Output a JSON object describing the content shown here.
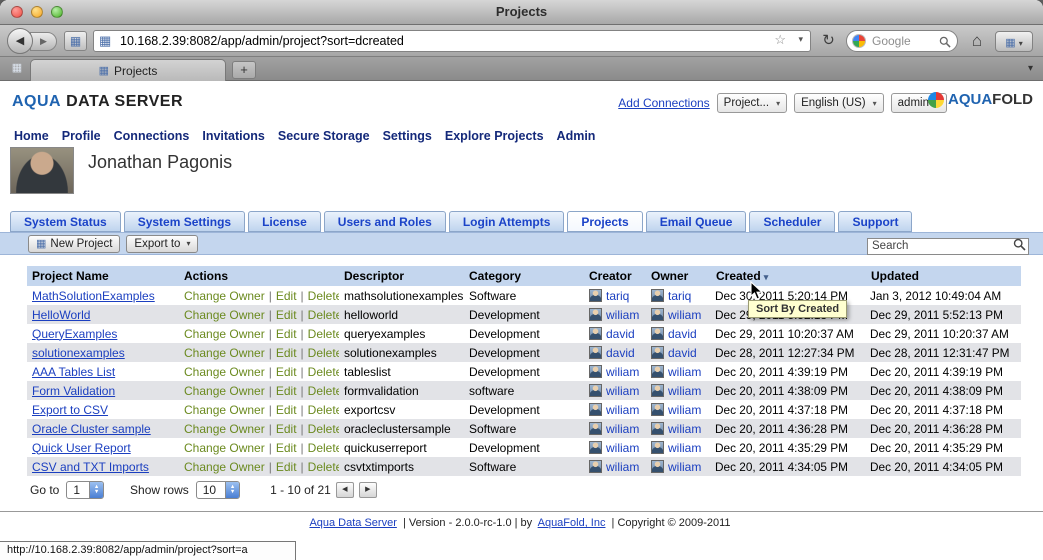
{
  "browser": {
    "window_title": "Projects",
    "url": "10.168.2.39:8082/app/admin/project?sort=dcreated",
    "search_placeholder": "Google",
    "tab_title": "Projects",
    "new_tab": "+",
    "status_url": "http://10.168.2.39:8082/app/admin/project?sort=a"
  },
  "icons": {
    "back": "◀",
    "forward": "▶",
    "grid": "▦",
    "star": "☆",
    "caret_small": "▾",
    "caret": "▼",
    "up": "▲",
    "down": "▼",
    "reload": "↻",
    "home": "⌂",
    "prev": "◀",
    "next": "▶",
    "sort_desc": "▾",
    "plus": "+"
  },
  "header": {
    "logo_aqua": "AQUA",
    "logo_rest": "DATA SERVER",
    "add_connections": "Add Connections",
    "project_select": "Project...",
    "language_select": "English (US)",
    "user_select": "admin",
    "aquafold_aqua": "AQUA",
    "aquafold_fold": "FOLD"
  },
  "nav": {
    "items": [
      "Home",
      "Profile",
      "Connections",
      "Invitations",
      "Secure Storage",
      "Settings",
      "Explore Projects",
      "Admin"
    ]
  },
  "user": {
    "name": "Jonathan Pagonis"
  },
  "tabs": {
    "items": [
      "System Status",
      "System Settings",
      "License",
      "Users and Roles",
      "Login Attempts",
      "Projects",
      "Email Queue",
      "Scheduler",
      "Support"
    ],
    "active": "Projects"
  },
  "toolbar": {
    "new_project": "New Project",
    "export_to": "Export to",
    "search_placeholder": "Search"
  },
  "table": {
    "columns": [
      "Project Name",
      "Actions",
      "Descriptor",
      "Category",
      "Creator",
      "Owner",
      "Created",
      "Updated"
    ],
    "sort_column": "Created",
    "actions": {
      "change_owner": "Change Owner",
      "edit": "Edit",
      "delete": "Delete",
      "separator": "|"
    },
    "rows": [
      {
        "name": "MathSolutionExamples",
        "descriptor": "mathsolutionexamples",
        "category": "Software",
        "creator": "tariq",
        "owner": "tariq",
        "created": "Dec 30, 2011 5:20:14 PM",
        "updated": "Jan 3, 2012 10:49:04 AM"
      },
      {
        "name": "HelloWorld",
        "descriptor": "helloworld",
        "category": "Development",
        "creator": "wiliam",
        "owner": "wiliam",
        "created": "Dec 29, 2011 5:52:13 PM",
        "updated": "Dec 29, 2011 5:52:13 PM"
      },
      {
        "name": "QueryExamples",
        "descriptor": "queryexamples",
        "category": "Development",
        "creator": "david",
        "owner": "david",
        "created": "Dec 29, 2011 10:20:37 AM",
        "updated": "Dec 29, 2011 10:20:37 AM"
      },
      {
        "name": "solutionexamples",
        "descriptor": "solutionexamples",
        "category": "Development",
        "creator": "david",
        "owner": "david",
        "created": "Dec 28, 2011 12:27:34 PM",
        "updated": "Dec 28, 2011 12:31:47 PM"
      },
      {
        "name": "AAA Tables List",
        "descriptor": "tableslist",
        "category": "Development",
        "creator": "wiliam",
        "owner": "wiliam",
        "created": "Dec 20, 2011 4:39:19 PM",
        "updated": "Dec 20, 2011 4:39:19 PM"
      },
      {
        "name": "Form Validation",
        "descriptor": "formvalidation",
        "category": "software",
        "creator": "wiliam",
        "owner": "wiliam",
        "created": "Dec 20, 2011 4:38:09 PM",
        "updated": "Dec 20, 2011 4:38:09 PM"
      },
      {
        "name": "Export to CSV",
        "descriptor": "exportcsv",
        "category": "Development",
        "creator": "wiliam",
        "owner": "wiliam",
        "created": "Dec 20, 2011 4:37:18 PM",
        "updated": "Dec 20, 2011 4:37:18 PM"
      },
      {
        "name": "Oracle Cluster sample",
        "descriptor": "oracleclustersample",
        "category": "Software",
        "creator": "wiliam",
        "owner": "wiliam",
        "created": "Dec 20, 2011 4:36:28 PM",
        "updated": "Dec 20, 2011 4:36:28 PM"
      },
      {
        "name": "Quick User Report",
        "descriptor": "quickuserreport",
        "category": "Development",
        "creator": "wiliam",
        "owner": "wiliam",
        "created": "Dec 20, 2011 4:35:29 PM",
        "updated": "Dec 20, 2011 4:35:29 PM"
      },
      {
        "name": "CSV and TXT Imports",
        "descriptor": "csvtxtimports",
        "category": "Software",
        "creator": "wiliam",
        "owner": "wiliam",
        "created": "Dec 20, 2011 4:34:05 PM",
        "updated": "Dec 20, 2011 4:34:05 PM"
      }
    ]
  },
  "tooltip": {
    "text": "Sort By Created"
  },
  "pagination": {
    "goto_label": "Go to",
    "goto_value": "1",
    "show_rows_label": "Show rows",
    "show_rows_value": "10",
    "range": "1 - 10 of 21"
  },
  "footer": {
    "app_link": "Aqua Data Server",
    "mid1": "| Version - 2.0.0-rc-1.0 | by",
    "company_link": "AquaFold, Inc",
    "mid2": "| Copyright © 2009-2011"
  }
}
